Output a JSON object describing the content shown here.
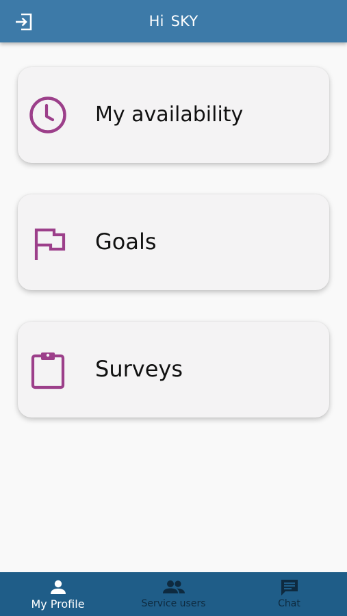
{
  "header": {
    "greeting": "Hi",
    "user_name": "SKY",
    "logout_icon": "logout-icon",
    "background_color": "#3d7aa8"
  },
  "menu": {
    "items": [
      {
        "label": "My availability",
        "icon": "clock-icon"
      },
      {
        "label": "Goals",
        "icon": "flag-icon"
      },
      {
        "label": "Surveys",
        "icon": "clipboard-icon"
      }
    ],
    "icon_color": "#9c3f8a"
  },
  "bottom_nav": {
    "background_color": "#1f5d88",
    "items": [
      {
        "label": "My Profile",
        "icon": "person-icon",
        "active": true
      },
      {
        "label": "Service users",
        "icon": "people-icon",
        "active": false
      },
      {
        "label": "Chat",
        "icon": "chat-icon",
        "active": false
      }
    ]
  }
}
